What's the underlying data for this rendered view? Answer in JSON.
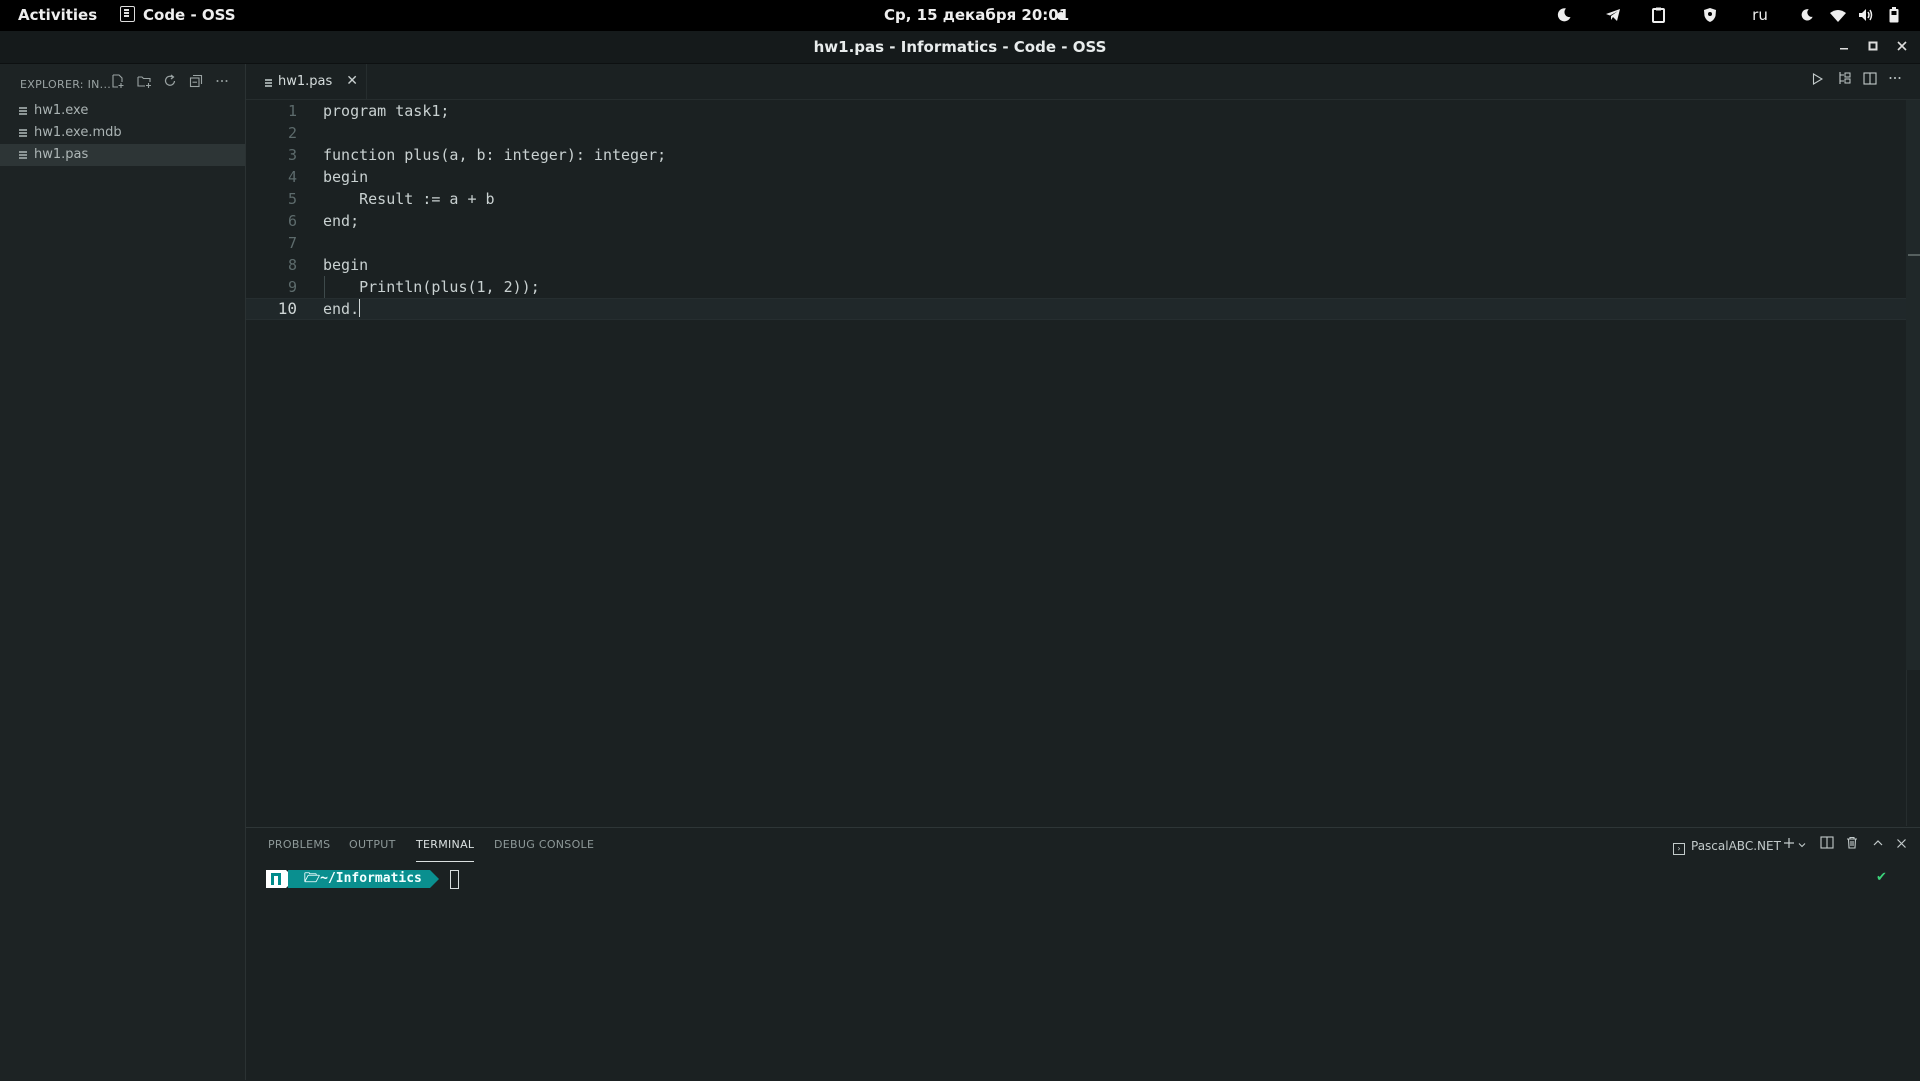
{
  "topbar": {
    "activities": "Activities",
    "app_name": "Code - OSS",
    "clock": "Ср, 15 декабря  20:01",
    "keyboard_layout": "ru"
  },
  "window": {
    "title": "hw1.pas - Informatics - Code - OSS"
  },
  "sidebar": {
    "title": "EXPLORER: IN...",
    "files": [
      {
        "name": "hw1.exe"
      },
      {
        "name": "hw1.exe.mdb"
      },
      {
        "name": "hw1.pas"
      }
    ]
  },
  "tabs": [
    {
      "label": "hw1.pas"
    }
  ],
  "editor": {
    "lines": [
      {
        "num": "1",
        "text": "program task1;"
      },
      {
        "num": "2",
        "text": ""
      },
      {
        "num": "3",
        "text": "function plus(a, b: integer): integer;"
      },
      {
        "num": "4",
        "text": "begin"
      },
      {
        "num": "5",
        "text": "    Result := a + b"
      },
      {
        "num": "6",
        "text": "end;"
      },
      {
        "num": "7",
        "text": ""
      },
      {
        "num": "8",
        "text": "begin"
      },
      {
        "num": "9",
        "text": "    Println(plus(1, 2));"
      },
      {
        "num": "10",
        "text": "end."
      }
    ],
    "current_line": 10
  },
  "panel": {
    "tabs": [
      "PROBLEMS",
      "OUTPUT",
      "TERMINAL",
      "DEBUG CONSOLE"
    ],
    "active_tab": "TERMINAL",
    "terminal_profile": "PascalABC.NET",
    "prompt_path": "~/Informatics",
    "status_mark": "✔"
  },
  "colors": {
    "editor_bg": "#1b2122",
    "prompt_accent": "#0a8f8f",
    "success": "#3bd37a"
  }
}
